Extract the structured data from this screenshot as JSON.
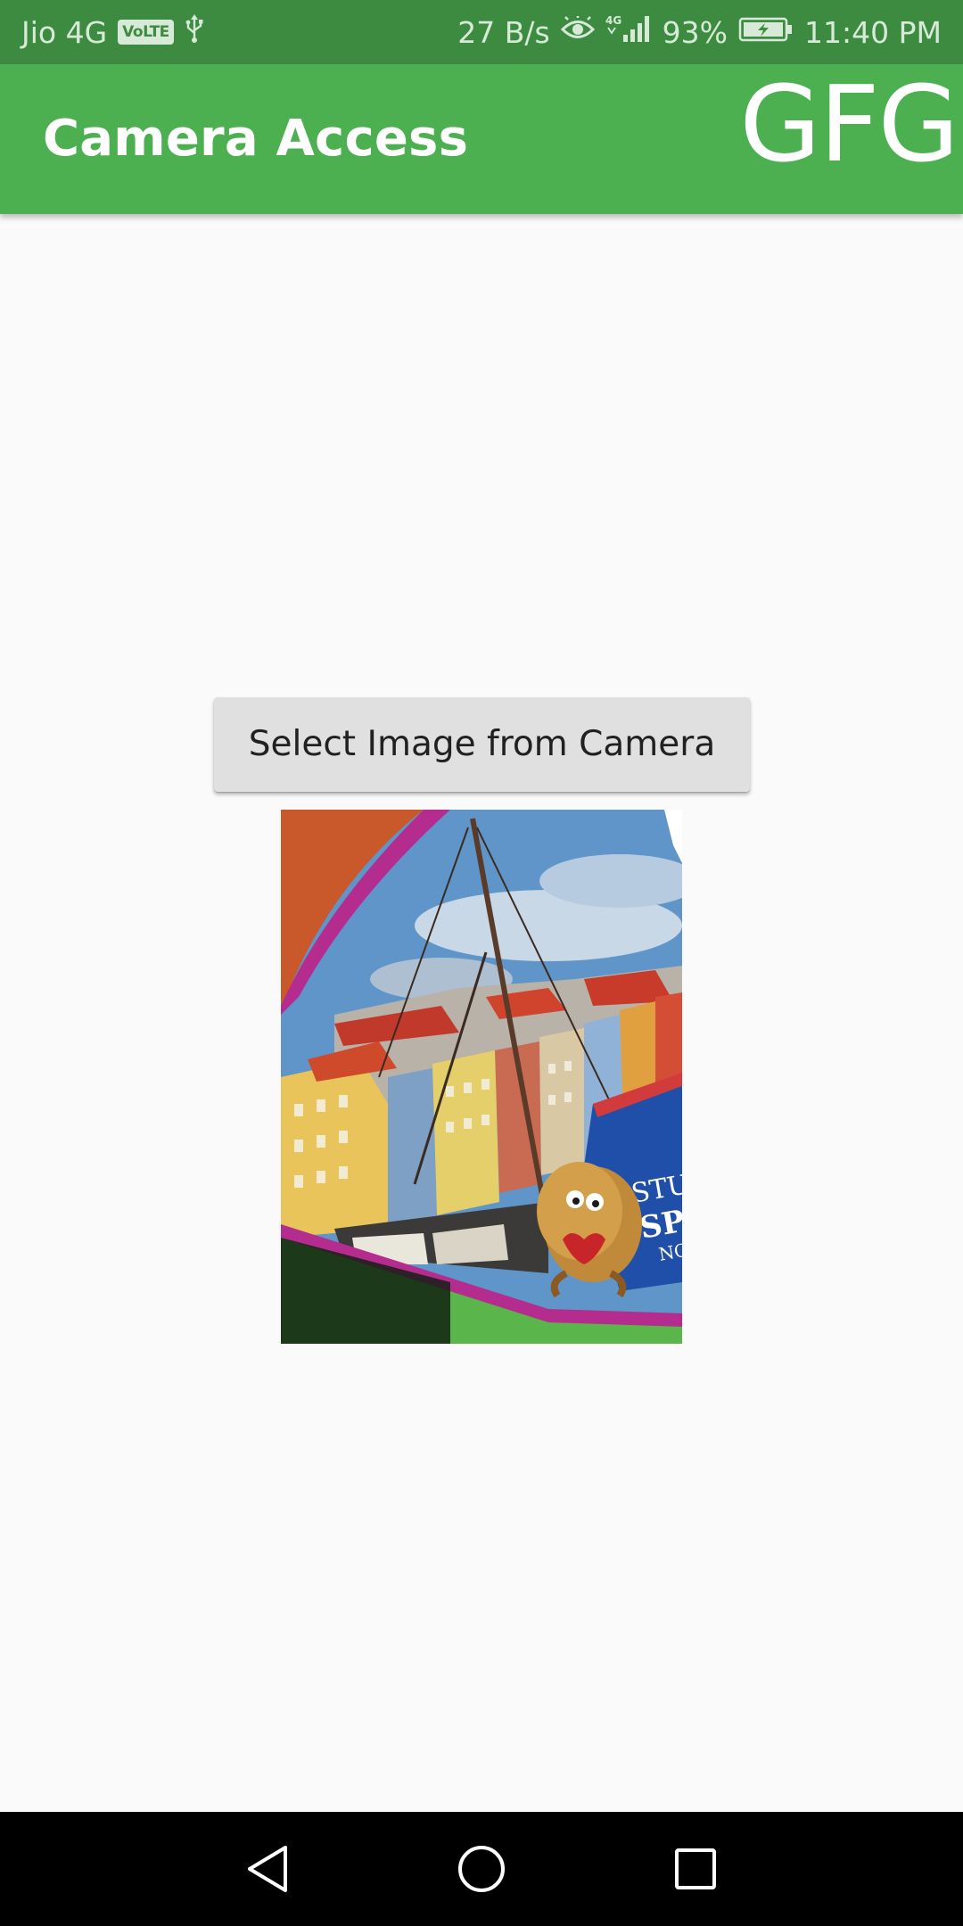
{
  "status_bar": {
    "carrier": "Jio 4G",
    "volte": "VoLTE",
    "network_speed": "27 B/s",
    "network_type": "4G",
    "battery": "93%",
    "time": "11:40 PM",
    "icons": [
      "usb-icon",
      "eye-icon",
      "signal-icon",
      "battery-charging-icon"
    ]
  },
  "app_bar": {
    "title": "Camera Access",
    "brand": "GFG",
    "color": "#4caf50",
    "status_color": "#3d8b40"
  },
  "main": {
    "select_button_label": "Select Image from Camera",
    "button_color": "#e0e0e0",
    "captured_image": {
      "present": true,
      "sign_text": [
        "STUD",
        "SPO",
        "NOT"
      ]
    }
  },
  "nav_bar": {
    "icons": [
      "back-icon",
      "home-icon",
      "recents-icon"
    ]
  }
}
